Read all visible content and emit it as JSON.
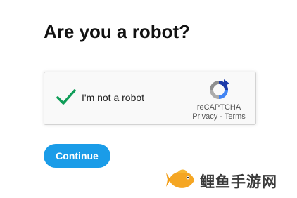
{
  "page": {
    "title": "Are you a robot?"
  },
  "captcha": {
    "checkbox_label": "I'm not a robot",
    "checked": true,
    "brand": "reCAPTCHA",
    "privacy_link": "Privacy",
    "separator": " - ",
    "terms_link": "Terms",
    "check_color": "#0f9d58"
  },
  "actions": {
    "continue_label": "Continue",
    "continue_color": "#1a9ce8"
  },
  "watermark": {
    "text": "鲤鱼手游网",
    "icon": "fish-logo-icon"
  }
}
